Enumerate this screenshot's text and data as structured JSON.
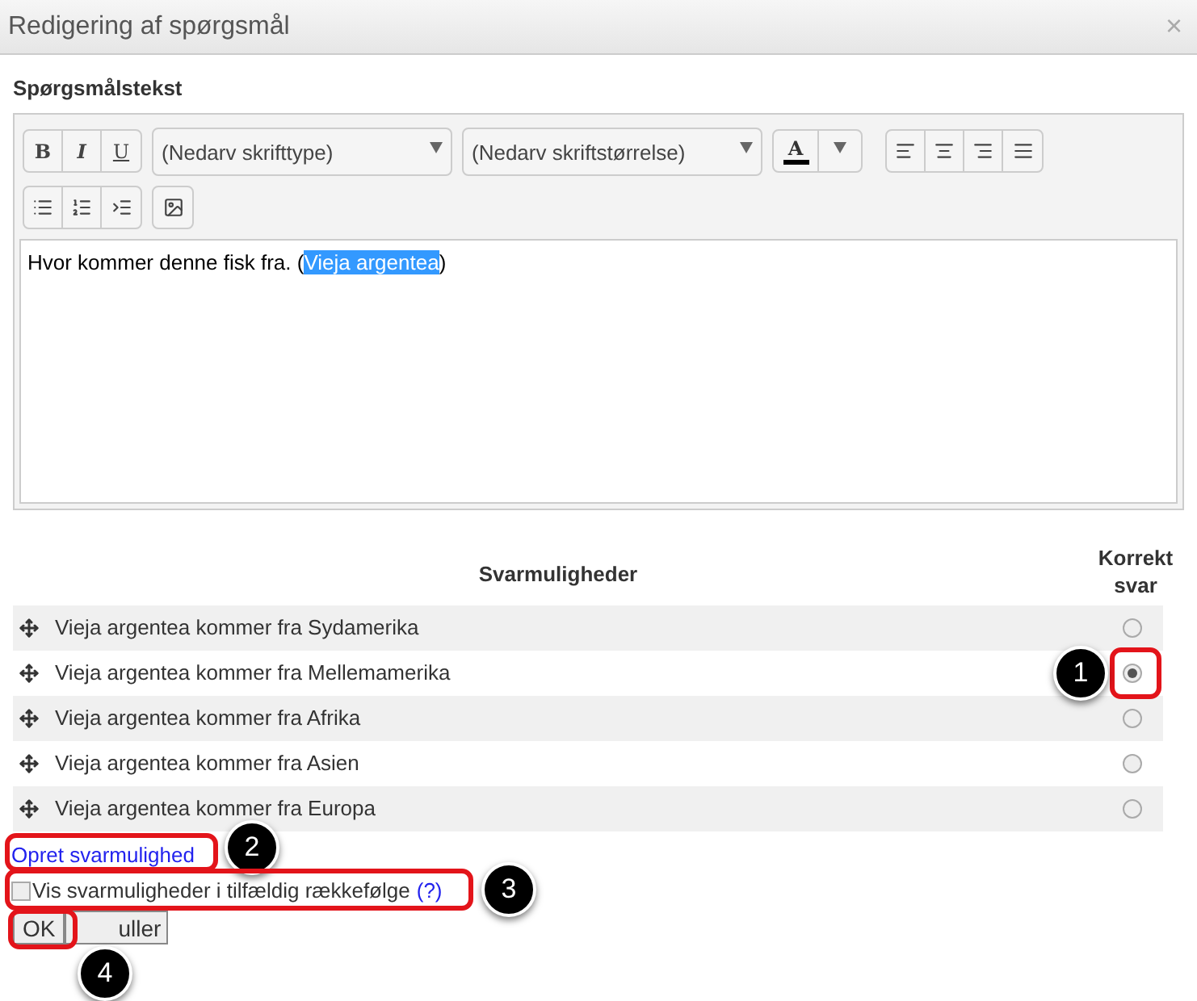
{
  "dialog": {
    "title": "Redigering af spørgsmål",
    "close": "×"
  },
  "question": {
    "label": "Spørgsmålstekst",
    "toolbar": {
      "bold": "B",
      "italic": "I",
      "underline": "U",
      "font": "(Nedarv skrifttype)",
      "size": "(Nedarv skriftstørrelse)",
      "text_color_label": "A"
    },
    "text": [
      {
        "text": "Hvor kommer denne fisk fra. (",
        "selected": false
      },
      {
        "text": "Vieja argentea",
        "selected": true
      },
      {
        "text": ")",
        "selected": false
      }
    ]
  },
  "answers": {
    "header": "Svarmuligheder",
    "correct_header": "Korrekt svar",
    "rows": [
      {
        "text": "Vieja argentea kommer fra Sydamerika",
        "selected": false
      },
      {
        "text": "Vieja argentea kommer fra Mellemamerika",
        "selected": true
      },
      {
        "text": "Vieja argentea kommer fra Afrika",
        "selected": false
      },
      {
        "text": "Vieja argentea kommer fra Asien",
        "selected": false
      },
      {
        "text": "Vieja argentea kommer fra Europa",
        "selected": false
      }
    ]
  },
  "add_link": "Opret svarmulighed",
  "shuffle": {
    "label": "Vis svarmuligheder i tilfældig rækkefølge",
    "help": "(?)",
    "checked": false
  },
  "buttons": {
    "ok": "OK",
    "cancel": "uller"
  },
  "callouts": [
    {
      "number": "1"
    },
    {
      "number": "2"
    },
    {
      "number": "3"
    },
    {
      "number": "4"
    }
  ]
}
